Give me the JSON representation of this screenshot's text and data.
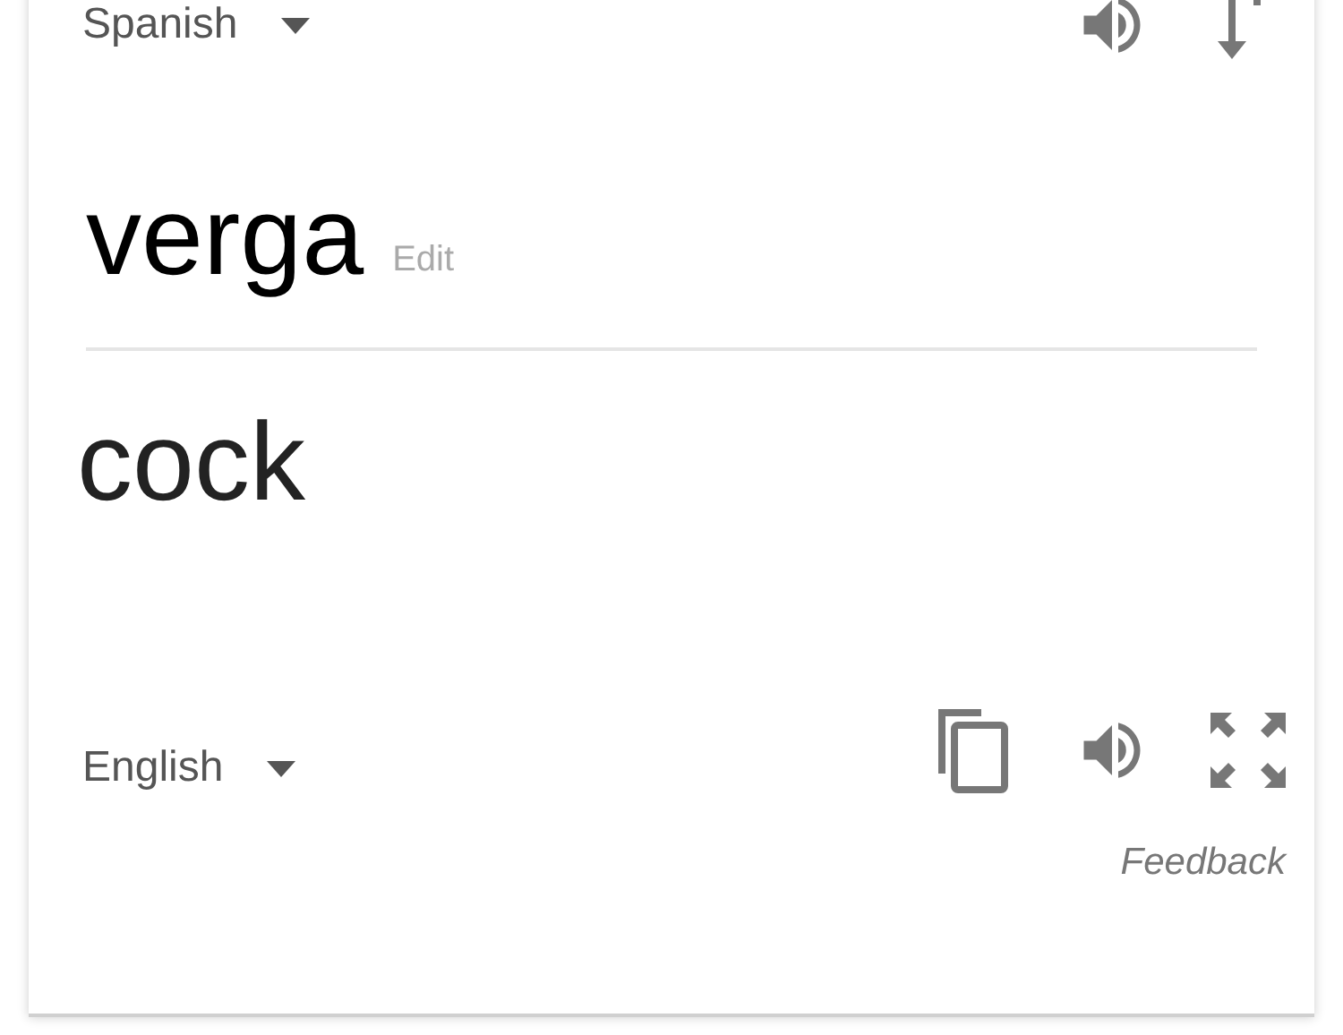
{
  "source": {
    "language": "Spanish",
    "text": "verga",
    "edit_label": "Edit"
  },
  "target": {
    "language": "English",
    "text": "cock"
  },
  "feedback": "Feedback"
}
